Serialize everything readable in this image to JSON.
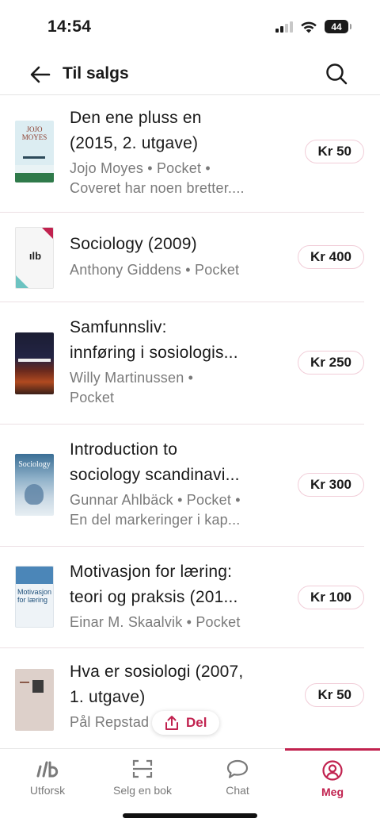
{
  "status_bar": {
    "time": "14:54",
    "battery": "44"
  },
  "header": {
    "title": "Til salgs",
    "back_icon": "arrow-left-icon",
    "search_icon": "search-icon"
  },
  "items": [
    {
      "title_line1": "Den ene pluss en",
      "title_line2": "(2015, 2. utgave)",
      "meta_line1": "Jojo Moyes • Pocket •",
      "meta_line2": "Coveret har noen bretter....",
      "price": "Kr 50",
      "cover_text": "JOJO MOYES"
    },
    {
      "title_line1": "Sociology (2009)",
      "title_line2": "",
      "meta_line1": "Anthony Giddens • Pocket",
      "meta_line2": "",
      "price": "Kr 400",
      "cover_text": "ılb"
    },
    {
      "title_line1": "Samfunnsliv:",
      "title_line2": "innføring i sosiologis...",
      "meta_line1": "Willy Martinussen •",
      "meta_line2": "Pocket",
      "price": "Kr 250",
      "cover_text": ""
    },
    {
      "title_line1": "Introduction to",
      "title_line2": "sociology scandinavi...",
      "meta_line1": "Gunnar Ahlbäck • Pocket •",
      "meta_line2": "En del markeringer i kap...",
      "price": "Kr 300",
      "cover_text": "Sociology"
    },
    {
      "title_line1": "Motivasjon for læring:",
      "title_line2": "teori og praksis (201...",
      "meta_line1": "Einar M. Skaalvik • Pocket",
      "meta_line2": "",
      "price": "Kr 100",
      "cover_text": "Motivasjon for læring"
    },
    {
      "title_line1": "Hva er sosiologi (2007,",
      "title_line2": "1. utgave)",
      "meta_line1": "Pål Repstad",
      "meta_line2": "",
      "price": "Kr 50",
      "cover_text": ""
    }
  ],
  "share_chip": {
    "label": "Del",
    "icon": "share-icon"
  },
  "tabs": [
    {
      "label": "Utforsk",
      "icon": "logo-icon",
      "active": false
    },
    {
      "label": "Selg en bok",
      "icon": "scan-icon",
      "active": false
    },
    {
      "label": "Chat",
      "icon": "chat-icon",
      "active": false
    },
    {
      "label": "Meg",
      "icon": "profile-icon",
      "active": true
    }
  ],
  "colors": {
    "accent": "#c1224f",
    "muted": "#7a7a7a",
    "divider": "#ecdfe4"
  }
}
